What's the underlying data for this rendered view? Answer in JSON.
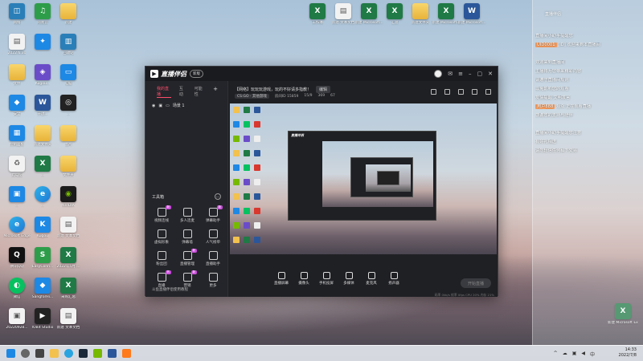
{
  "desktop_left": [
    {
      "label": "网络",
      "color": "c-teal",
      "glyph": "◫"
    },
    {
      "label": "网易云",
      "color": "c-green",
      "glyph": "♫"
    },
    {
      "label": "新建",
      "color": "c-folder",
      "glyph": ""
    },
    {
      "label": "2022.6.30",
      "color": "c-doc",
      "glyph": "▤"
    },
    {
      "label": "",
      "color": "c-blue",
      "glyph": "✦"
    },
    {
      "label": "回收站",
      "color": "c-teal",
      "glyph": "▥"
    },
    {
      "label": "文件",
      "color": "c-folder",
      "glyph": ""
    },
    {
      "label": "Kugou...",
      "color": "c-purple",
      "glyph": "◈"
    },
    {
      "label": "电脑",
      "color": "c-blue",
      "glyph": "▭"
    },
    {
      "label": "安全",
      "color": "c-blue",
      "glyph": "◆"
    },
    {
      "label": "开放...",
      "color": "c-word",
      "glyph": "W"
    },
    {
      "label": "...",
      "color": "c-dark",
      "glyph": "◎"
    },
    {
      "label": "控制面板",
      "color": "c-blue",
      "glyph": "▦"
    },
    {
      "label": "新建文件夹",
      "color": "c-folder",
      "glyph": ""
    },
    {
      "label": "图片",
      "color": "c-folder",
      "glyph": ""
    },
    {
      "label": "此电脑",
      "color": "c-doc",
      "glyph": "♻"
    },
    {
      "label": "...",
      "color": "c-excel",
      "glyph": "X"
    },
    {
      "label": "文件夹",
      "color": "c-folder",
      "glyph": ""
    },
    {
      "label": "...",
      "color": "c-blue",
      "glyph": "▣"
    },
    {
      "label": "...",
      "color": "c-edge",
      "glyph": "e"
    },
    {
      "label": "NVIDIA",
      "color": "c-nvidia",
      "glyph": "◉"
    },
    {
      "label": "Microsoft Edge",
      "color": "c-edge",
      "glyph": "e"
    },
    {
      "label": "Kugou",
      "color": "c-blue",
      "glyph": "K"
    },
    {
      "label": "新建 文本文档",
      "color": "c-doc",
      "glyph": "▤"
    },
    {
      "label": "腾讯QQ",
      "color": "c-qq",
      "glyph": "Q"
    },
    {
      "label": "EasyConn...",
      "color": "c-green",
      "glyph": "S"
    },
    {
      "label": "2022年5月 ...",
      "color": "c-excel",
      "glyph": "X"
    },
    {
      "label": "微信",
      "color": "c-wechat",
      "glyph": "◐"
    },
    {
      "label": "SangforHi...",
      "color": "c-blue",
      "glyph": "◆"
    },
    {
      "label": "采购汇总",
      "color": "c-excel",
      "glyph": "X"
    },
    {
      "label": "20220928...",
      "color": "c-doc",
      "glyph": "▣"
    },
    {
      "label": "IOBit Studio",
      "color": "c-dark",
      "glyph": "▶"
    },
    {
      "label": "新建 文本文档",
      "color": "c-doc",
      "glyph": "▤"
    }
  ],
  "desktop_top": [
    {
      "label": "工作簿",
      "color": "c-excel",
      "glyph": "X"
    },
    {
      "label": "新建 文本文档",
      "color": "c-doc",
      "glyph": "▤"
    },
    {
      "label": "新建 Microsoft...",
      "color": "c-excel",
      "glyph": "X"
    },
    {
      "label": "汇总",
      "color": "c-excel",
      "glyph": "X"
    },
    {
      "label": "新建文件夹",
      "color": "c-folder",
      "glyph": ""
    },
    {
      "label": "新建 Microsoft...",
      "color": "c-excel",
      "glyph": "X"
    },
    {
      "label": "新建 Microsoft...",
      "color": "c-word",
      "glyph": "W"
    }
  ],
  "desktop_bottom_right": {
    "label": "新建 Microsoft Ex...",
    "color": "c-excel",
    "glyph": "X"
  },
  "chat": {
    "title": "直播伴侣",
    "lines": [
      {
        "text": "直播间小助手提醒您",
        "highlight": ""
      },
      {
        "text": "[ID] 欢迎来到本直播间",
        "highlight": "UID0001"
      },
      {
        "text": "",
        "highlight": ""
      },
      {
        "text": "欢迎来到直播间",
        "highlight": ""
      },
      {
        "text": "主播将为您带来精彩内容",
        "highlight": ""
      },
      {
        "text": "请遵守直播间规则",
        "highlight": ""
      },
      {
        "text": "以免影响您的观看",
        "highlight": ""
      },
      {
        "text": "友情提醒 文明发言",
        "highlight": ""
      },
      {
        "text": "观众 正在观看直播",
        "highlight": "用户888"
      },
      {
        "text": "感谢您的支持与陪伴",
        "highlight": ""
      },
      {
        "text": "",
        "highlight": ""
      },
      {
        "text": "直播间小助手提醒您注意",
        "highlight": ""
      },
      {
        "text": "有好礼相送",
        "highlight": ""
      },
      {
        "text": "请勿轻信任何私下交易",
        "highlight": ""
      }
    ]
  },
  "window": {
    "app_title": "直播伴侣",
    "version": "新版",
    "tabs": [
      "我的直播",
      "互动",
      "可能性"
    ],
    "scene_name": "场景 1",
    "tools_title": "工具箱",
    "tools": [
      {
        "label": "视频连线",
        "badge": "新"
      },
      {
        "label": "多人连麦",
        "badge": ""
      },
      {
        "label": "弹幕助手",
        "badge": "新"
      },
      {
        "label": "虚拟形象",
        "badge": ""
      },
      {
        "label": "弹幕墙",
        "badge": ""
      },
      {
        "label": "人气榜单",
        "badge": ""
      },
      {
        "label": "粉丝团",
        "badge": ""
      },
      {
        "label": "直播管理",
        "badge": "新"
      },
      {
        "label": "直播助手",
        "badge": ""
      },
      {
        "label": "直播",
        "badge": "热"
      },
      {
        "label": "营销",
        "badge": "新"
      },
      {
        "label": "更多",
        "badge": ""
      }
    ],
    "notice": "斗鱼直播伴侣使用教程",
    "live_title": "【网络】玩玩玩游戏，玩的不好请多指教！",
    "edit_label": "编辑",
    "meta": {
      "category": "CS:GO · 其他游戏",
      "room_id": "房间ID 15859",
      "followers": "15/9",
      "fans": "369",
      "hearts": "67"
    },
    "bottom_items": [
      "直播屏幕",
      "摄像头",
      "手机投屏",
      "多媒体",
      "麦克风",
      "扬声器"
    ],
    "start_button": "开始直播",
    "status_line": "码率 0kb/s  帧率 0fps  CPU 20%  内存 21%"
  },
  "taskbar": {
    "tray_icons": [
      "^",
      "☁",
      "▣",
      "◀",
      "中"
    ],
    "time": "14:33",
    "date": "2022/7/8"
  }
}
